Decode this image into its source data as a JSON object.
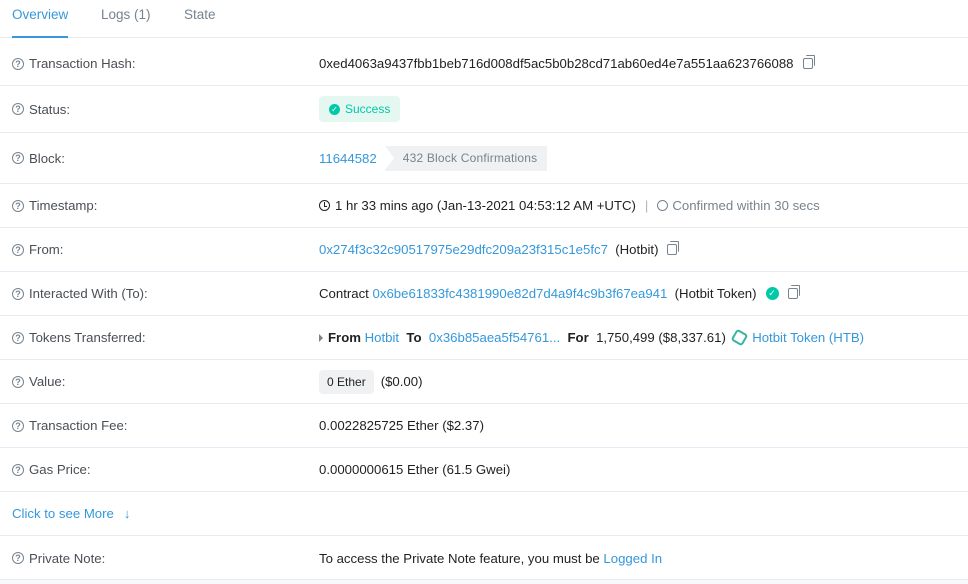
{
  "tabs": [
    "Overview",
    "Logs (1)",
    "State"
  ],
  "rows": {
    "hash": {
      "label": "Transaction Hash:",
      "value": "0xed4063a9437fbb1beb716d008df5ac5b0b28cd71ab60ed4e7a551aa623766088"
    },
    "status": {
      "label": "Status:",
      "value": "Success"
    },
    "block": {
      "label": "Block:",
      "value": "11644582",
      "confirmations": "432 Block Confirmations"
    },
    "timestamp": {
      "label": "Timestamp:",
      "value": "1 hr 33 mins ago (Jan-13-2021 04:53:12 AM +UTC)",
      "sep": "|",
      "confirmed": "Confirmed within 30 secs"
    },
    "from": {
      "label": "From:",
      "address": "0x274f3c32c90517975e29dfc209a23f315c1e5fc7",
      "name": "(Hotbit)"
    },
    "to": {
      "label": "Interacted With (To):",
      "prefix": "Contract",
      "address": "0x6be61833fc4381990e82d7d4a9f4c9b3f67ea941",
      "name": "(Hotbit Token)"
    },
    "tokens": {
      "label": "Tokens Transferred:",
      "from_label": "From",
      "from": "Hotbit",
      "to_label": "To",
      "to": "0x36b85aea5f54761...",
      "for_label": "For",
      "amount": "1,750,499",
      "usd": "($8,337.61)",
      "token": "Hotbit Token (HTB)"
    },
    "value": {
      "label": "Value:",
      "ether": "0 Ether",
      "usd": "($0.00)"
    },
    "fee": {
      "label": "Transaction Fee:",
      "value": "0.0022825725 Ether ($2.37)"
    },
    "gas": {
      "label": "Gas Price:",
      "value": "0.0000000615 Ether (61.5 Gwei)"
    },
    "more": {
      "label": "Click to see More",
      "arrow": "↓"
    },
    "note": {
      "label": "Private Note:",
      "text": "To access the Private Note feature, you must be",
      "link": "Logged In"
    }
  },
  "colors": {
    "accent": "#3498db",
    "success": "#00c9a7",
    "muted": "#77838f"
  },
  "icons": {
    "help": "?",
    "check": "✓"
  }
}
